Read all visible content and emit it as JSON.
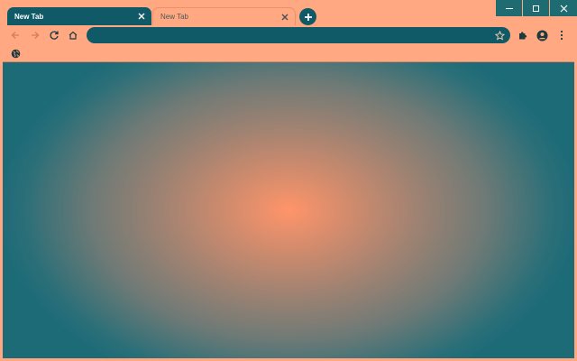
{
  "window": {
    "controls": {
      "minimize_icon": "minimize-icon",
      "maximize_icon": "maximize-icon",
      "close_icon": "close-icon"
    }
  },
  "tabs": [
    {
      "title": "New Tab",
      "active": true
    },
    {
      "title": "New Tab",
      "active": false
    }
  ],
  "toolbar": {
    "address": {
      "value": "",
      "placeholder": ""
    }
  },
  "colors": {
    "frame": "#ffa882",
    "accent": "#0f5a66",
    "page_center": "#ff946a",
    "page_edge": "#1e6b78"
  }
}
